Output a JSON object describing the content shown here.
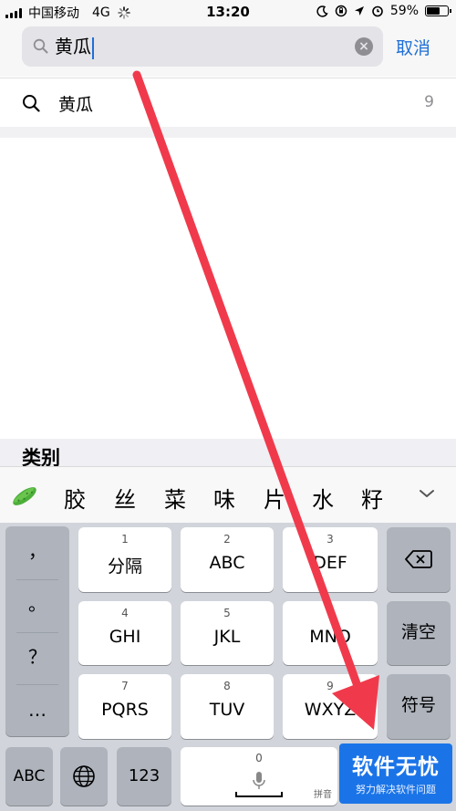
{
  "status_bar": {
    "carrier": "中国移动",
    "network": "4G",
    "time": "13:20",
    "battery": "59%",
    "battery_level": 0.59
  },
  "search": {
    "query": "黄瓜",
    "cancel_label": "取消"
  },
  "suggestion": {
    "text": "黄瓜",
    "count": "9"
  },
  "section": {
    "title": "类别"
  },
  "candidates": [
    "胶",
    "丝",
    "菜",
    "味",
    "片",
    "水",
    "籽"
  ],
  "keyboard": {
    "punctuation": [
      "，",
      "。",
      "？",
      "…"
    ],
    "rows": [
      [
        {
          "num": "1",
          "label": "分隔"
        },
        {
          "num": "2",
          "label": "ABC"
        },
        {
          "num": "3",
          "label": "DEF"
        }
      ],
      [
        {
          "num": "4",
          "label": "GHI"
        },
        {
          "num": "5",
          "label": "JKL"
        },
        {
          "num": "6",
          "label": "MNO"
        }
      ],
      [
        {
          "num": "7",
          "label": "PQRS"
        },
        {
          "num": "8",
          "label": "TUV"
        },
        {
          "num": "9",
          "label": "WXYZ"
        }
      ]
    ],
    "clear_label": "清空",
    "symbol_label": "符号",
    "abc_label": "ABC",
    "numbers_label": "123",
    "space_num": "0",
    "pinyin_label": "拼音"
  },
  "watermark": {
    "title": "软件无忧",
    "subtitle": "努力解决软件问题"
  },
  "colors": {
    "accent": "#1f6fd6",
    "arrow": "#f03a4c",
    "keyboard_bg": "#d1d4da",
    "watermark_bg": "#1a74e8"
  }
}
